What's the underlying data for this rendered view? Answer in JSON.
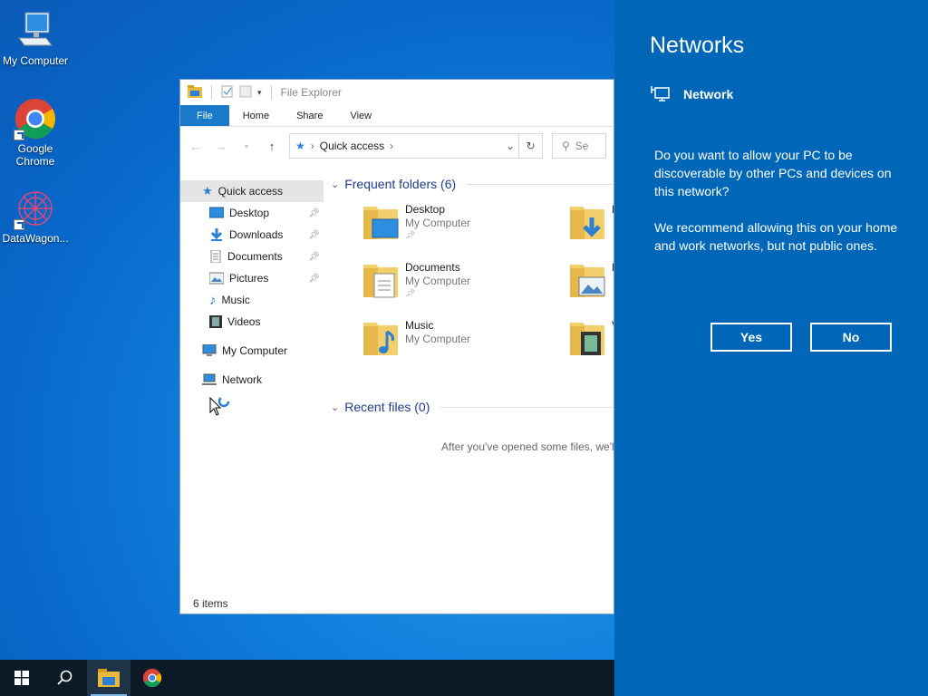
{
  "desktop": {
    "icons": [
      {
        "label": "My Computer"
      },
      {
        "label": "Google Chrome"
      },
      {
        "label": "DataWagon..."
      }
    ]
  },
  "explorer": {
    "title": "File Explorer",
    "tabs": [
      "File",
      "Home",
      "Share",
      "View"
    ],
    "address": {
      "crumb": "Quick access"
    },
    "search_placeholder": "Se",
    "nav": {
      "quick_access": "Quick access",
      "items": [
        "Desktop",
        "Downloads",
        "Documents",
        "Pictures",
        "Music",
        "Videos"
      ],
      "my_computer": "My Computer",
      "network": "Network"
    },
    "frequent": {
      "header": "Frequent folders (6)",
      "folders": [
        {
          "name": "Desktop",
          "location": "My Computer"
        },
        {
          "name": "Documents",
          "location": "My Computer"
        },
        {
          "name": "Music",
          "location": "My Computer"
        }
      ],
      "partial": [
        "D",
        "P",
        "V"
      ]
    },
    "recent": {
      "header": "Recent files (0)",
      "empty_message": "After you've opened some files, we'l"
    },
    "status": "6 items"
  },
  "networks_panel": {
    "title": "Networks",
    "network_name": "Network",
    "question": "Do you want to allow your PC to be discoverable by other PCs and devices on this network?",
    "recommendation": "We recommend allowing this on your home and work networks, but not public ones.",
    "yes_label": "Yes",
    "no_label": "No"
  },
  "colors": {
    "panel_bg": "#0067b8",
    "file_tab": "#1979ca",
    "taskbar": "#0b1a26"
  }
}
